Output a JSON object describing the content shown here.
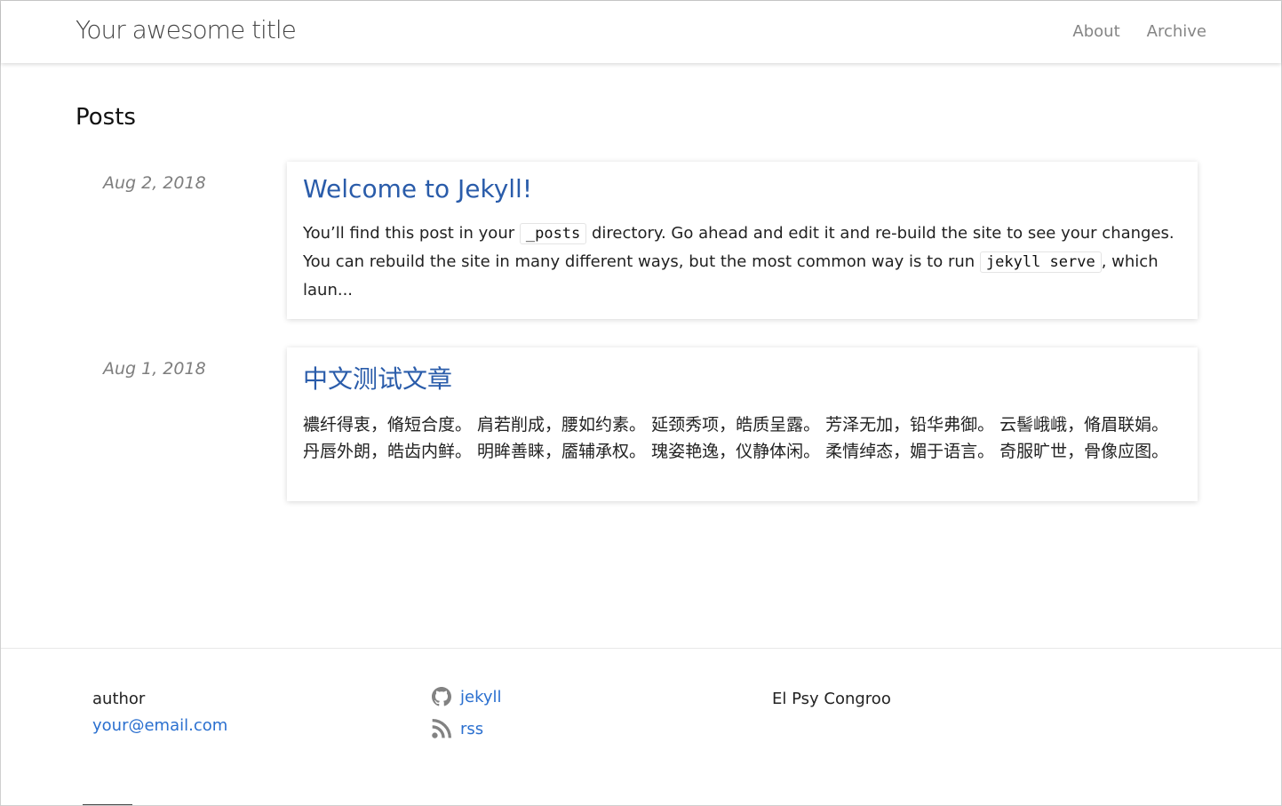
{
  "header": {
    "site_title": "Your awesome title",
    "nav": [
      {
        "label": "About"
      },
      {
        "label": "Archive"
      }
    ]
  },
  "main": {
    "heading": "Posts",
    "posts": [
      {
        "date": "Aug 2, 2018",
        "title": "Welcome to Jekyll!",
        "excerpt_parts": {
          "t1": "You’ll find this post in your ",
          "code1": "_posts",
          "t2": " directory. Go ahead and edit it and re-build the site to see your changes. You can rebuild the site in many different ways, but the most common way is to run ",
          "code2": "jekyll serve",
          "t3": ", which laun..."
        }
      },
      {
        "date": "Aug 1, 2018",
        "title": "中文测试文章",
        "excerpt": "襛纤得衷，脩短合度。 肩若削成，腰如约素。 延颈秀项，皓质呈露。 芳泽无加，铅华弗御。 云髻峨峨，脩眉联娟。 丹唇外朗，皓齿内鲜。 明眸善睐，靥辅承权。 瑰姿艳逸，仪静体闲。 柔情绰态，媚于语言。 奇服旷世，骨像应图。"
      }
    ]
  },
  "footer": {
    "author_name": "author",
    "email": "your@email.com",
    "social": [
      {
        "icon": "github-icon",
        "label": "jekyll"
      },
      {
        "icon": "rss-icon",
        "label": "rss"
      }
    ],
    "tagline": "El Psy Congroo"
  },
  "colors": {
    "link": "#2a5caa",
    "footer_link": "#2a6fcf",
    "nav": "#858585",
    "date": "#7e7e7e"
  }
}
